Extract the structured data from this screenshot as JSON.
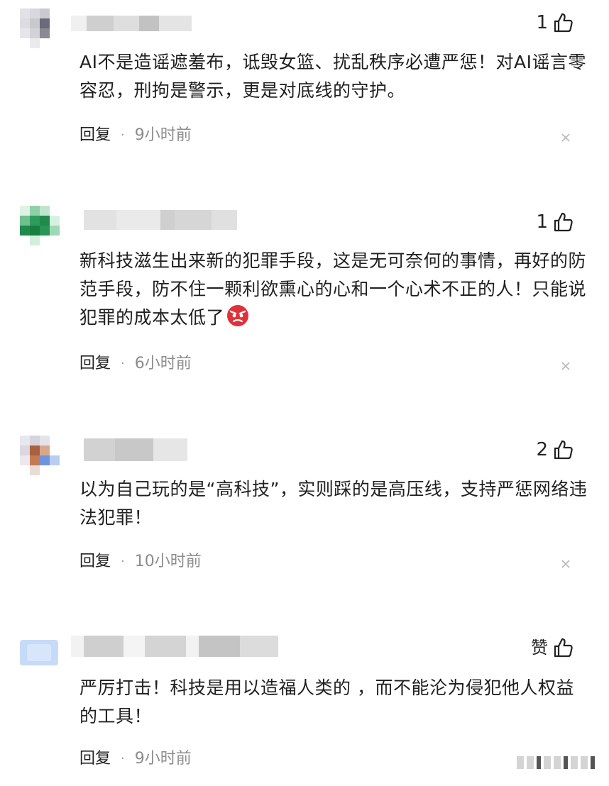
{
  "comments": [
    {
      "likes": "1",
      "text": "AI不是造谣遮羞布，诋毁女篮、扰乱秩序必遭严惩！对AI谣言零容忍，刑拘是警示，更是对底线的守护。",
      "reply_label": "回复",
      "separator": "·",
      "time": "9小时前"
    },
    {
      "likes": "1",
      "text": "新科技滋生出来新的犯罪手段，这是无可奈何的事情，再好的防范手段，防不住一颗利欲熏心的心和一个心术不正的人！只能说犯罪的成本太低了",
      "emoji": "angry-face-emoji",
      "reply_label": "回复",
      "separator": "·",
      "time": "6小时前"
    },
    {
      "likes": "2",
      "text": "以为自己玩的是“高科技”，实则踩的是高压线，支持严惩网络违法犯罪！",
      "reply_label": "回复",
      "separator": "·",
      "time": "10小时前"
    },
    {
      "likes": "赞",
      "text": "严厉打击！科技是用以造福人类的 ，而不能沦为侵犯他人权益的工具！",
      "reply_label": "回复",
      "separator": "·",
      "time": "9小时前"
    }
  ],
  "colors": {
    "text": "#1f1f1f",
    "meta_time": "#8c8c8c",
    "angry_emoji": "#e0303a"
  },
  "icons": {
    "like": "thumbs-up-icon",
    "close": "close-icon"
  }
}
